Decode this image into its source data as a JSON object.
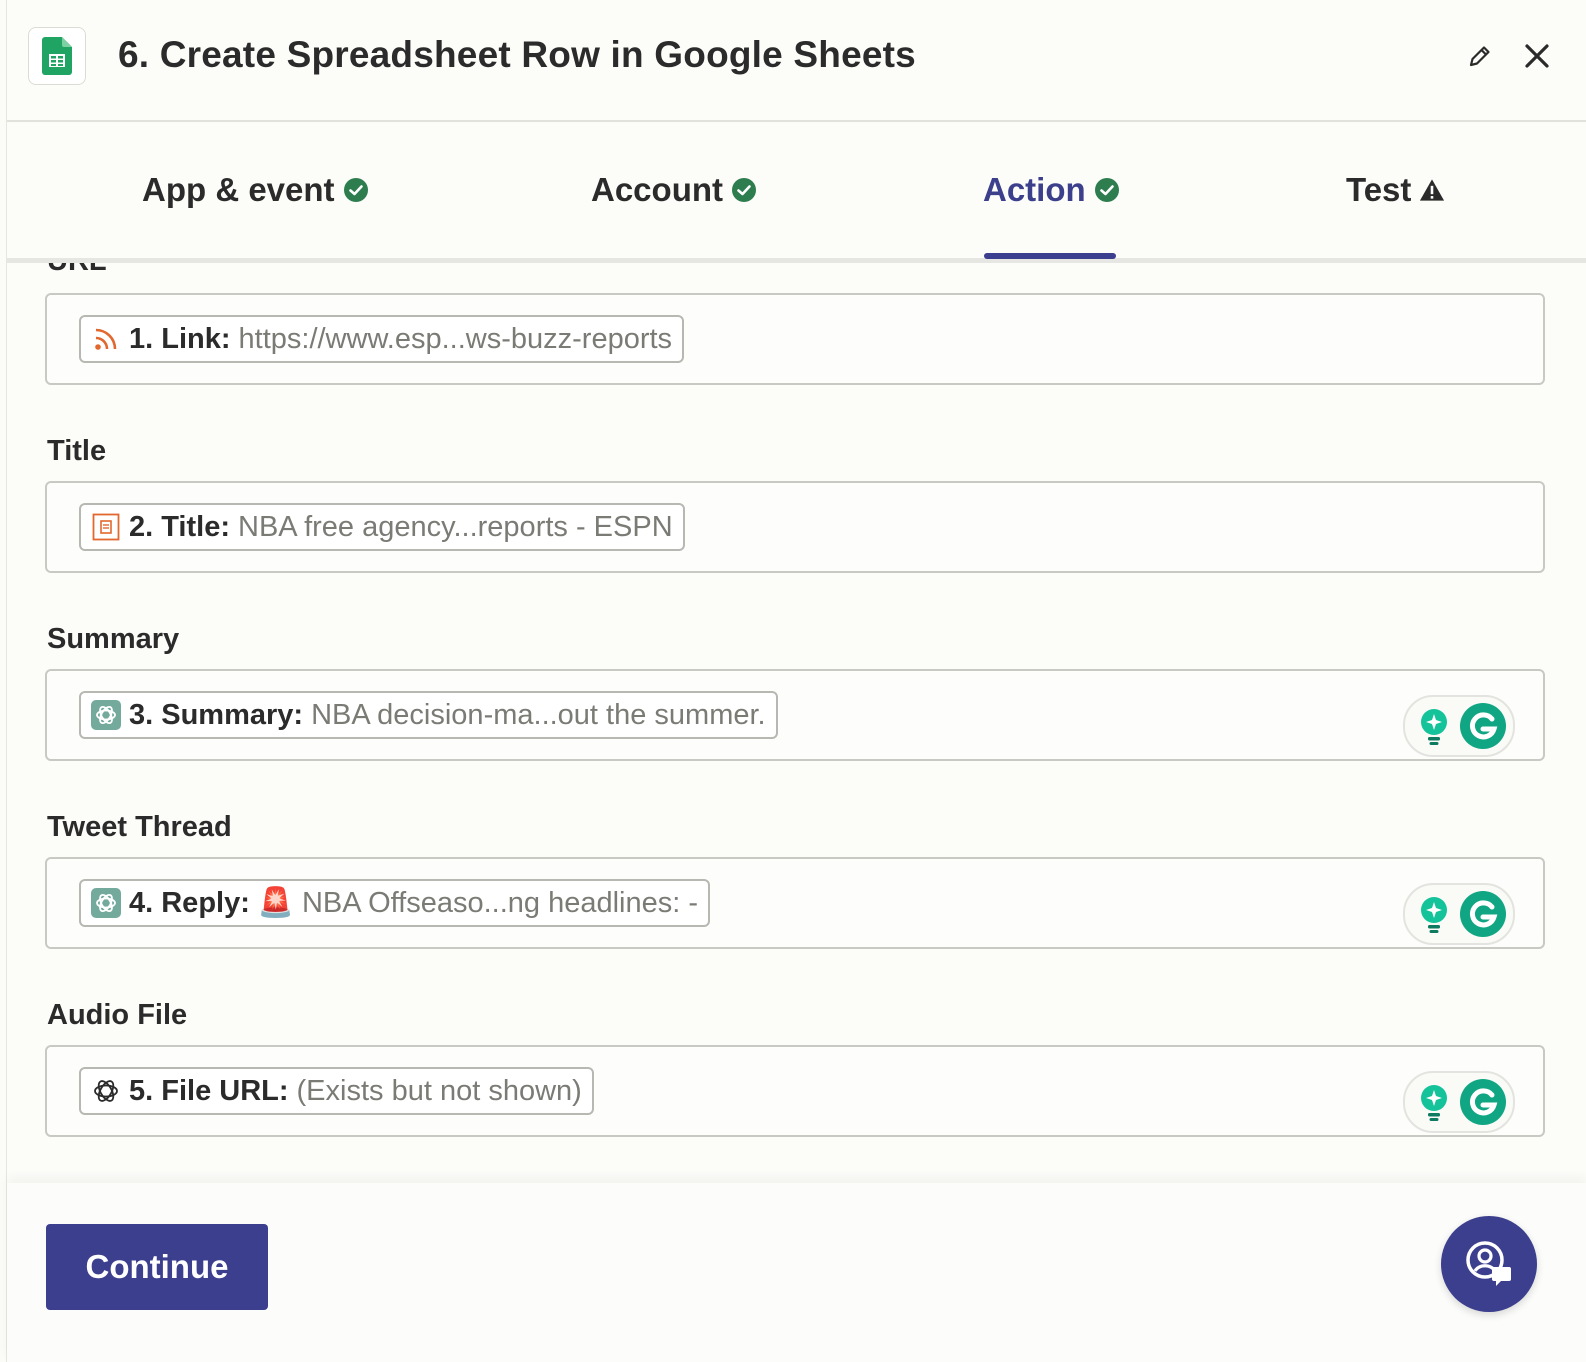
{
  "header": {
    "title": "6. Create Spreadsheet Row in Google Sheets"
  },
  "tabs": [
    {
      "label": "App & event",
      "status": "complete"
    },
    {
      "label": "Account",
      "status": "complete"
    },
    {
      "label": "Action",
      "status": "complete",
      "active": true
    },
    {
      "label": "Test",
      "status": "warning"
    }
  ],
  "fields": [
    {
      "label": "URL",
      "pill_key": "1. Link:",
      "pill_value": "https://www.esp...ws-buzz-reports",
      "icon": "rss-icon"
    },
    {
      "label": "Title",
      "pill_key": "2. Title:",
      "pill_value": "NBA free agency...reports - ESPN",
      "icon": "document-icon"
    },
    {
      "label": "Summary",
      "pill_key": "3. Summary:",
      "pill_value": "NBA decision-ma...out the summer.",
      "icon": "openai-icon"
    },
    {
      "label": "Tweet Thread",
      "pill_key": "4. Reply:",
      "pill_value": "NBA Offseaso...ng headlines: -",
      "prefix_emoji": "🚨",
      "icon": "openai-icon"
    },
    {
      "label": "Audio File",
      "pill_key": "5. File URL:",
      "pill_value": "(Exists but not shown)",
      "icon": "openai-outline-icon"
    }
  ],
  "footer": {
    "continue_label": "Continue"
  },
  "colors": {
    "accent": "#3b3f8d",
    "success": "#2e7d4f",
    "rss": "#e2682f",
    "openai": "#74aa9c"
  }
}
